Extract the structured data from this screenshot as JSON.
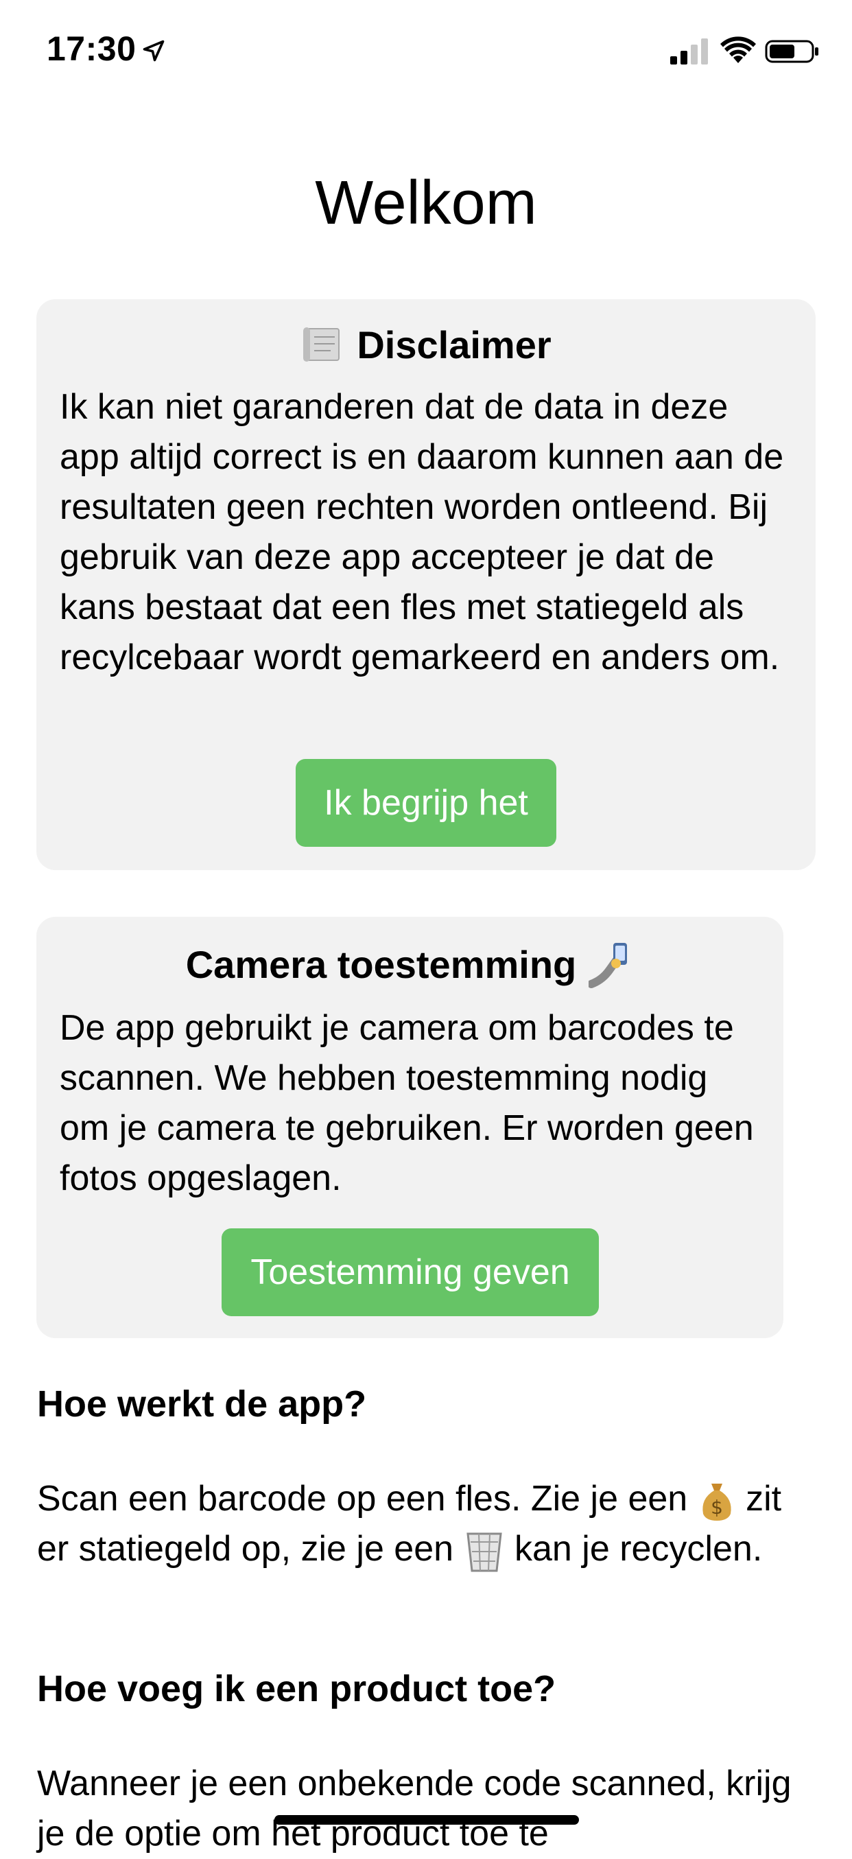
{
  "status_bar": {
    "time": "17:30",
    "icons": [
      "location-arrow-icon",
      "cellular-signal-icon",
      "wifi-icon",
      "battery-icon"
    ]
  },
  "page": {
    "title": "Welkom"
  },
  "disclaimer": {
    "icon": "scroll-icon",
    "title": "Disclaimer",
    "body": "Ik kan niet garanderen dat de data in deze app altijd correct is en daarom kunnen aan de resultaten geen rechten worden ontleend. Bij gebruik van deze app accepteer je dat de kans bestaat dat een fles met statiegeld als recylcebaar wordt gemarkeerd en anders om.",
    "button_label": "Ik begrijp het"
  },
  "camera": {
    "title": "Camera toestemming",
    "icon": "selfie-arm-icon",
    "body": "De app gebruikt je camera om barcodes te scannen. We hebben toestemming nodig om je camera te gebruiken. Er worden geen fotos opgeslagen.",
    "button_label": "Toestemming geven"
  },
  "how_it_works": {
    "heading": "Hoe werkt de app?",
    "text_part1": "Scan een barcode op een fles. Zie je een",
    "text_part2": "zit er statiegeld op, zie je een",
    "text_part3": "kan je recyclen.",
    "icons": [
      "money-bag-icon",
      "wastebasket-icon"
    ]
  },
  "add_product": {
    "heading": "Hoe voeg ik een product toe?",
    "text": "Wanneer je een onbekende code scanned, krijg je de optie om het product toe te"
  },
  "colors": {
    "accent_green": "#66c466",
    "card_background": "#f2f2f2"
  }
}
